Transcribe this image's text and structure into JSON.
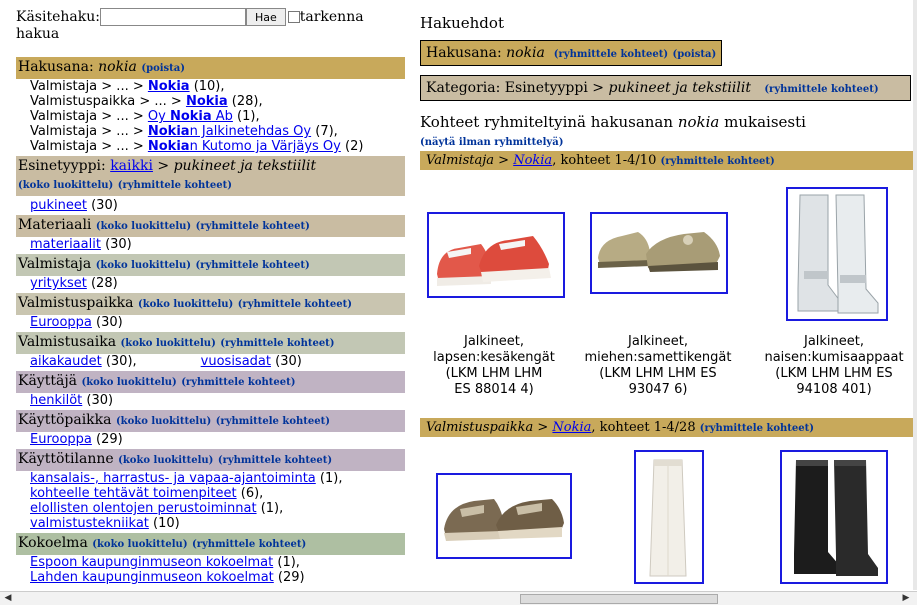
{
  "search": {
    "label": "Käsitehaku:",
    "value": "",
    "button": "Hae",
    "refine_label": "tarkenna hakua"
  },
  "left": {
    "keyword_header": {
      "label": "Hakusana:",
      "term": "nokia",
      "remove": "(poista)"
    },
    "keyword_items": [
      {
        "prefix": "Valmistaja > ... > ",
        "link": "Nokia",
        "suffix": " (10),"
      },
      {
        "prefix": "Valmistuspaikka > ... > ",
        "link": "Nokia",
        "suffix": " (28),"
      },
      {
        "prefix": "Valmistaja > ... > ",
        "link_pre": "Oy ",
        "link_bold": "Nokia",
        "link_post": " Ab",
        "suffix": " (1),"
      },
      {
        "prefix": "Valmistaja > ... > ",
        "link_bold": "Nokia",
        "link_post": "n Jalkinetehdas Oy",
        "suffix": " (7),"
      },
      {
        "prefix": "Valmistaja > ... > ",
        "link_bold": "Nokia",
        "link_post": "n Kutomo ja Värjäys Oy",
        "suffix": " (2)"
      }
    ],
    "object_type": {
      "label": "Esinetyyppi:",
      "link": "kaikki",
      "rest": " > pukineet ja tekstiilit",
      "full": "(koko luokittelu)",
      "group": "(ryhmittele kohteet)",
      "item": "pukineet",
      "count": " (30)"
    },
    "facets": [
      {
        "key": "materiaali",
        "title": "Materiaali",
        "full": "(koko luokittelu)",
        "group": "(ryhmittele kohteet)",
        "items": [
          {
            "link": "materiaalit",
            "count": " (30)"
          }
        ]
      },
      {
        "key": "valmistaja",
        "title": "Valmistaja",
        "full": "(koko luokittelu)",
        "group": "(ryhmittele kohteet)",
        "items": [
          {
            "link": "yritykset",
            "count": " (28)"
          }
        ]
      },
      {
        "key": "valmistuspaikka",
        "title": "Valmistuspaikka",
        "full": "(koko luokittelu)",
        "group": "(ryhmittele kohteet)",
        "items": [
          {
            "link": "Eurooppa",
            "count": " (30)"
          }
        ]
      },
      {
        "key": "valmistusaika",
        "title": "Valmistusaika",
        "full": "(koko luokittelu)",
        "group": "(ryhmittele kohteet)",
        "items": [
          {
            "link": "aikakaudet",
            "count": " (30),"
          },
          {
            "link": "vuosisadat",
            "count": " (30)"
          }
        ]
      },
      {
        "key": "kayttaja",
        "title": "Käyttäjä",
        "full": "(koko luokittelu)",
        "group": "(ryhmittele kohteet)",
        "items": [
          {
            "link": "henkilöt",
            "count": " (30)"
          }
        ]
      },
      {
        "key": "kayttopaikka",
        "title": "Käyttöpaikka",
        "full": "(koko luokittelu)",
        "group": "(ryhmittele kohteet)",
        "items": [
          {
            "link": "Eurooppa",
            "count": " (29)"
          }
        ]
      },
      {
        "key": "kayttotilanne",
        "title": "Käyttötilanne",
        "full": "(koko luokittelu)",
        "group": "(ryhmittele kohteet)",
        "items": [
          {
            "link": "kansalais-, harrastus- ja vapaa-ajantoiminta",
            "count": " (1),"
          },
          {
            "link": "kohteelle tehtävät toimenpiteet",
            "count": " (6),"
          },
          {
            "link": "elollisten olentojen perustoiminnat",
            "count": " (1),"
          },
          {
            "link": "valmistustekniikat",
            "count": " (10)"
          }
        ]
      },
      {
        "key": "kokoelma",
        "title": "Kokoelma",
        "full": "(koko luokittelu)",
        "group": "(ryhmittele kohteet)",
        "items": [
          {
            "link": "Espoon kaupunginmuseon kokoelmat",
            "count": " (1),"
          },
          {
            "link": "Lahden kaupunginmuseon kokoelmat",
            "count": " (29)"
          }
        ]
      }
    ]
  },
  "right": {
    "heading": "Hakuehdot",
    "keyword_box": {
      "label": "Hakusana:",
      "term": "nokia",
      "group": "(ryhmittele kohteet)",
      "remove": "(poista)"
    },
    "category_box": {
      "label": "Kategoria:",
      "value": "Esinetyyppi > ",
      "value_it": "pukineet ja tekstiilit",
      "group": "(ryhmittele kohteet)"
    },
    "results_title_pre": "Kohteet ryhmiteltyinä hakusanan ",
    "results_title_term": "nokia",
    "results_title_post": " mukaisesti",
    "show_ungrouped": "(näytä ilman ryhmittelyä)",
    "group1": {
      "prefix": "Valmistaja > ",
      "link": "Nokia",
      "suffix": ", kohteet 1-4/10 ",
      "group": "(ryhmittele kohteet)"
    },
    "group2": {
      "prefix": "Valmistuspaikka > ",
      "link": "Nokia",
      "suffix": ", kohteet 1-4/28 ",
      "group": "(ryhmittele kohteet)"
    },
    "items1": [
      {
        "l1": "Jalkineet,",
        "l2": "lapsen:kesäkengät",
        "l3": "(LKM LHM LHM",
        "l4": "ES 88014 4)"
      },
      {
        "l1": "Jalkineet,",
        "l2": "miehen:samettikengät",
        "l3": "(LKM LHM LHM ES",
        "l4": "93047 6)"
      },
      {
        "l1": "Jalkineet,",
        "l2": "naisen:kumisaappaat",
        "l3": "(LKM LHM LHM ES",
        "l4": "94108 401)"
      }
    ]
  }
}
